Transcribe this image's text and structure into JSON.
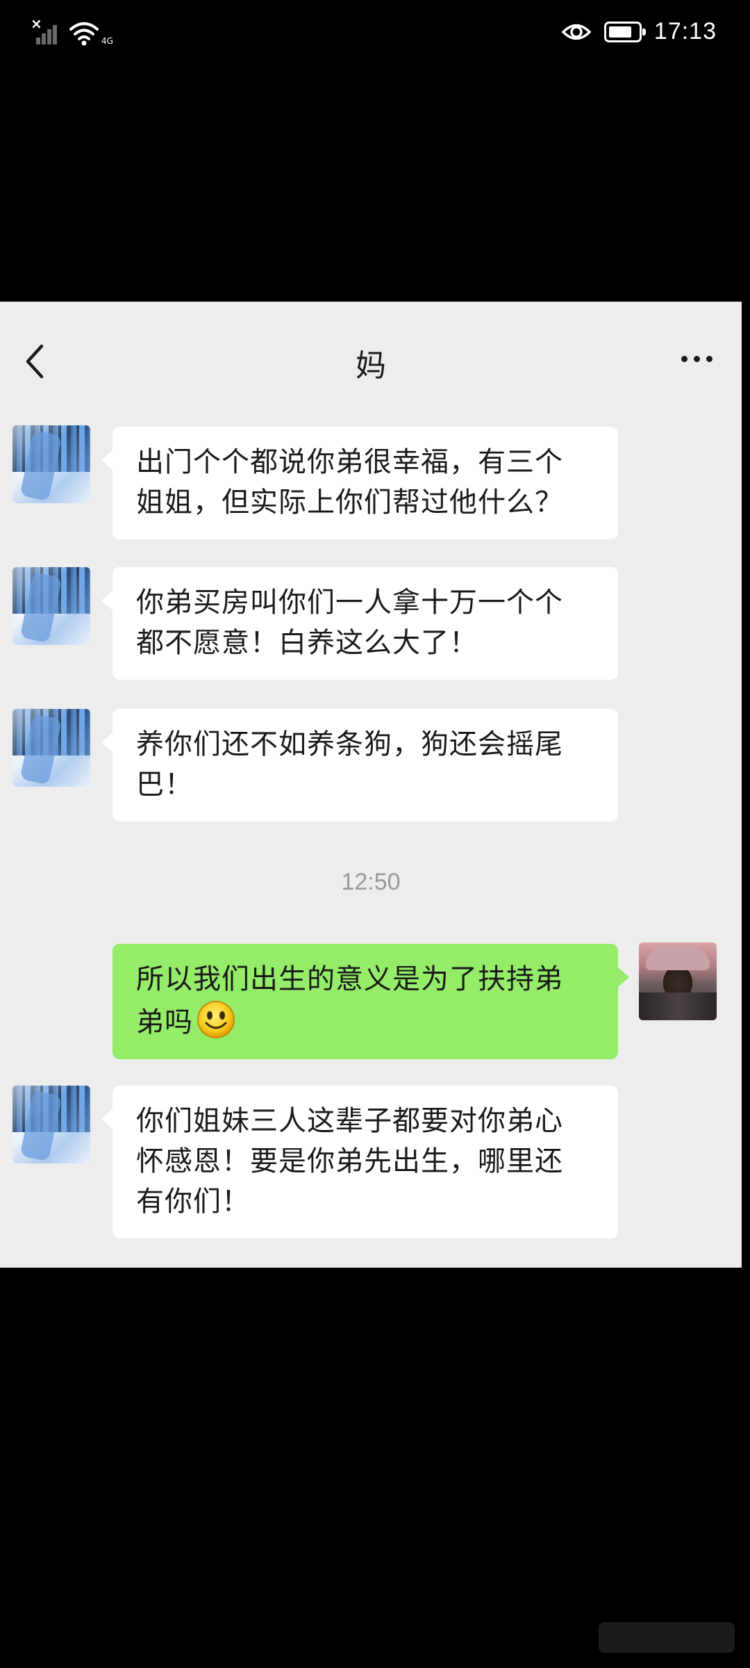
{
  "status_bar": {
    "time": "17:13",
    "wifi_tag": "4G",
    "battery_level": 0.8,
    "icons": [
      "no-sim-signal-icon",
      "wifi-icon",
      "eye-icon",
      "battery-icon"
    ]
  },
  "chat": {
    "title": "妈",
    "timestamp": "12:50",
    "messages": [
      {
        "sender": "mom",
        "text_line1": "出门个个都说你弟很幸福，有三个",
        "text_line2": "姐姐，但实际上你们帮过他什么？"
      },
      {
        "sender": "mom",
        "text_line1": "你弟买房叫你们一人拿十万一个个",
        "text_line2": "都不愿意！白养这么大了！"
      },
      {
        "sender": "mom",
        "text_line1": "养你们还不如养条狗，狗还会摇尾",
        "text_line2": "巴！"
      },
      {
        "sender": "me",
        "text_line1": "所以我们出生的意义是为了扶持弟",
        "text_line2": "弟吗",
        "emoji": "smile-emoji"
      },
      {
        "sender": "mom",
        "text_line1": "你们姐妹三人这辈子都要对你弟心",
        "text_line2": "怀感恩！要是你弟先出生，哪里还",
        "text_line3": "有你们！"
      }
    ]
  },
  "colors": {
    "background": "#000000",
    "chat_bg": "#ededed",
    "incoming_bubble": "#ffffff",
    "outgoing_bubble": "#95ec69",
    "timestamp_text": "#9a9a9a"
  }
}
